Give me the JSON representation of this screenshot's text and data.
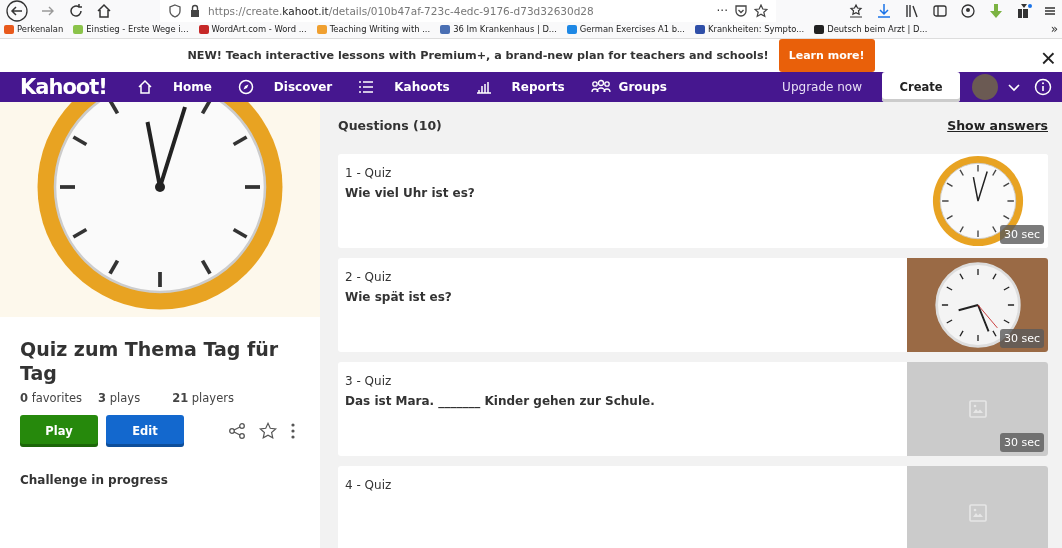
{
  "browser": {
    "url_prefix": "https://create.",
    "url_domain": "kahoot.it",
    "url_path": "/details/010b47af-723c-4edc-9176-d73d32630d28",
    "more": "···"
  },
  "bookmarks": [
    {
      "label": "Perkenalan",
      "color": "#e8591c"
    },
    {
      "label": "Einstieg - Erste Wege i...",
      "color": "#8bc34a"
    },
    {
      "label": "WordArt.com - Word ...",
      "color": "#c62828"
    },
    {
      "label": "Teaching Writing with ...",
      "color": "#f0a030"
    },
    {
      "label": "36 Im Krankenhaus | D...",
      "color": "#4a6fb3"
    },
    {
      "label": "German Exercises A1 b...",
      "color": "#1e88e5"
    },
    {
      "label": "Krankheiten: Sympto...",
      "color": "#2f4fa8"
    },
    {
      "label": "Deutsch beim Arzt | D...",
      "color": "#222222"
    }
  ],
  "bookmarks_more": "»",
  "banner": {
    "text": "NEW! Teach interactive lessons with Premium+, a brand-new plan for teachers and schools!",
    "button": "Learn more!",
    "close": "×"
  },
  "nav": {
    "logo": "Kahoot!",
    "items": [
      {
        "label": "Home",
        "kind": "home"
      },
      {
        "label": "Discover",
        "kind": "discover"
      },
      {
        "label": "Kahoots",
        "kind": "list"
      },
      {
        "label": "Reports",
        "kind": "reports"
      },
      {
        "label": "Groups",
        "kind": "groups"
      }
    ],
    "upgrade": "Upgrade now",
    "create": "Create"
  },
  "kahoot": {
    "title": "Quiz zum Thema Tag für Tag",
    "stats": [
      "**0** favorites",
      "**3** plays",
      "**21** players"
    ],
    "play": "Play",
    "edit": "Edit",
    "challenge": "Challenge in progress"
  },
  "questions_header": {
    "title": "Questions (10)",
    "show_answers": "Show answers"
  },
  "questions": [
    {
      "number": "1 - Quiz",
      "text": "Wie viel Uhr ist es?",
      "time": "30 sec",
      "kind": "clock"
    },
    {
      "number": "2 - Quiz",
      "text": "Wie spät ist es?",
      "time": "30 sec",
      "kind": "photo"
    },
    {
      "number": "3 - Quiz",
      "text": "Das ist Mara. _______ Kinder gehen zur Schule.",
      "time": "30 sec",
      "kind": "placeholder"
    },
    {
      "number": "4 - Quiz",
      "kind": "placeholder"
    }
  ]
}
